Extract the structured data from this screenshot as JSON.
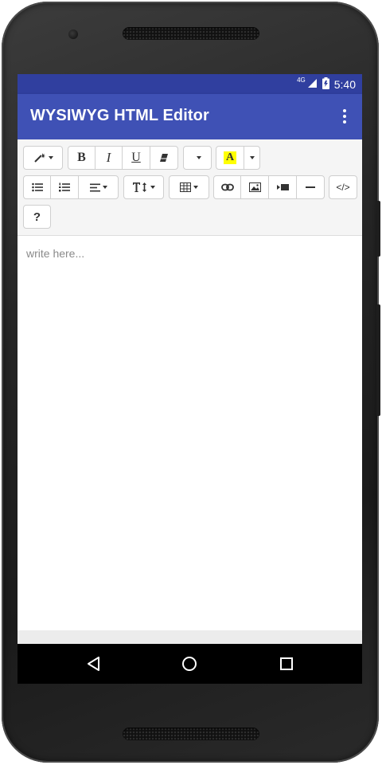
{
  "status_bar": {
    "network": "4G",
    "time": "5:40"
  },
  "app_bar": {
    "title": "WYSIWYG HTML Editor"
  },
  "toolbar": {
    "bold_label": "B",
    "italic_label": "I",
    "underline_label": "U",
    "highlight_label": "A",
    "highlight_color": "#ffff00",
    "help_label": "?",
    "code_view_label": "</>"
  },
  "editor": {
    "placeholder": "write here..."
  },
  "colors": {
    "status_bar": "#303f9f",
    "app_bar": "#3f51b5",
    "toolbar_bg": "#f5f5f5"
  }
}
